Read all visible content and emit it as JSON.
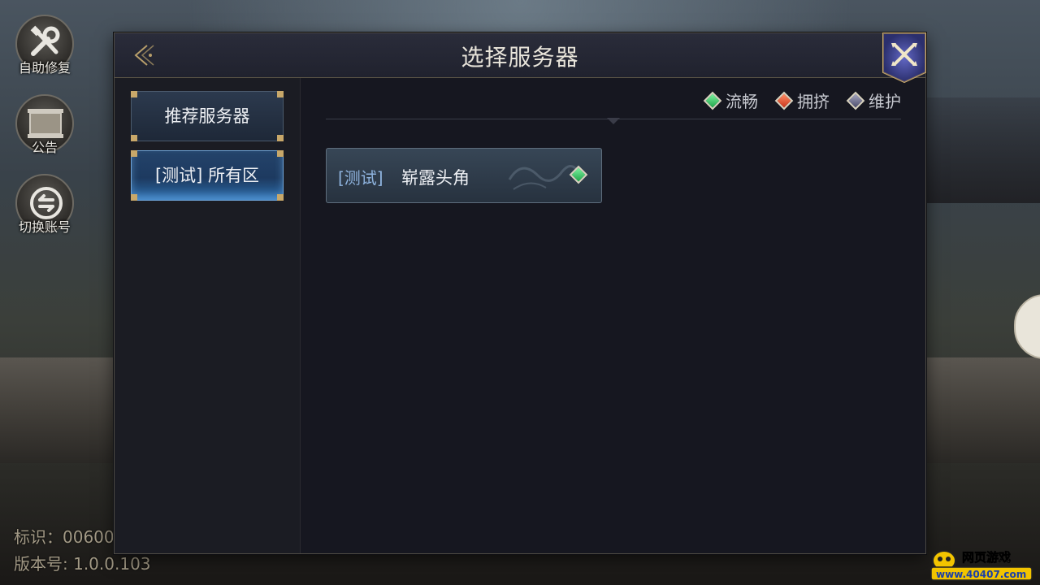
{
  "side_buttons": [
    {
      "label": "自助修复",
      "icon": "tools-icon"
    },
    {
      "label": "公告",
      "icon": "board-icon"
    },
    {
      "label": "切换账号",
      "icon": "switch-icon"
    }
  ],
  "footer": {
    "identifier": "标识：00600",
    "version": "版本号: 1.0.0.103"
  },
  "dialog": {
    "title": "选择服务器",
    "tabs": [
      {
        "label": "推荐服务器",
        "selected": false
      },
      {
        "label": "[测试] 所有区",
        "selected": true
      }
    ],
    "legend": [
      {
        "label": "流畅",
        "icon": "gem-green-icon",
        "color": "#2ecc5a"
      },
      {
        "label": "拥挤",
        "icon": "gem-red-icon",
        "color": "#e0482a"
      },
      {
        "label": "维护",
        "icon": "gem-gray-icon",
        "color": "#6f70a0"
      }
    ],
    "servers": [
      {
        "tag": "[测试]",
        "name": "崭露头角",
        "status": "流畅"
      }
    ]
  },
  "watermark": {
    "line1": "网页游戏",
    "line2": "www.40407.com"
  }
}
